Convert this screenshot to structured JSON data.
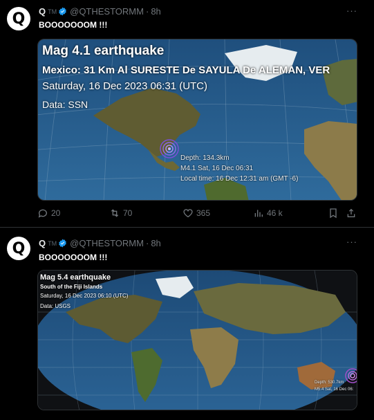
{
  "tweets": [
    {
      "avatar_letter": "Q",
      "name": "Q",
      "tm": "TM",
      "handle": "@QTHESTORMM",
      "dot": "·",
      "time": "8h",
      "more": "···",
      "text": "BOOOOOOOM !!!",
      "media": {
        "title": "Mag 4.1 earthquake",
        "location": "Mexico: 31 Km Al SURESTE De SAYULA De ALEMAN, VER",
        "datetime": "Saturday, 16 Dec 2023 06:31 (UTC)",
        "source": "Data: SSN",
        "info": [
          "Depth: 134.3km",
          "M4.1 Sat, 16 Dec 06:31",
          "Local time: 16 Dec 12:31 am (GMT -6)"
        ]
      },
      "actions": {
        "reply": "20",
        "retweet": "70",
        "like": "365",
        "views": "46 k"
      }
    },
    {
      "avatar_letter": "Q",
      "name": "Q",
      "tm": "TM",
      "handle": "@QTHESTORMM",
      "dot": "·",
      "time": "8h",
      "more": "···",
      "text": "BOOOOOOOM !!!",
      "media": {
        "title": "Mag 5.4 earthquake",
        "location": "South of the Fiji Islands",
        "datetime": "Saturday, 16 Dec 2023 06:10 (UTC)",
        "source": "Data: USGS",
        "info": [
          "Depth: 530.7km",
          "M5.4 Sat, 16 Dec 06:"
        ]
      }
    }
  ],
  "colors": {
    "background": "#000000",
    "verified": "#1d9bf0",
    "muted": "#71767b",
    "ocean": "#2f6a9b",
    "land": "#6b6a3a",
    "quake_ring": "#7a4fd8"
  },
  "icons": [
    "verified-badge-icon",
    "more-icon",
    "reply-icon",
    "retweet-icon",
    "like-icon",
    "views-icon",
    "bookmark-icon",
    "share-icon"
  ]
}
